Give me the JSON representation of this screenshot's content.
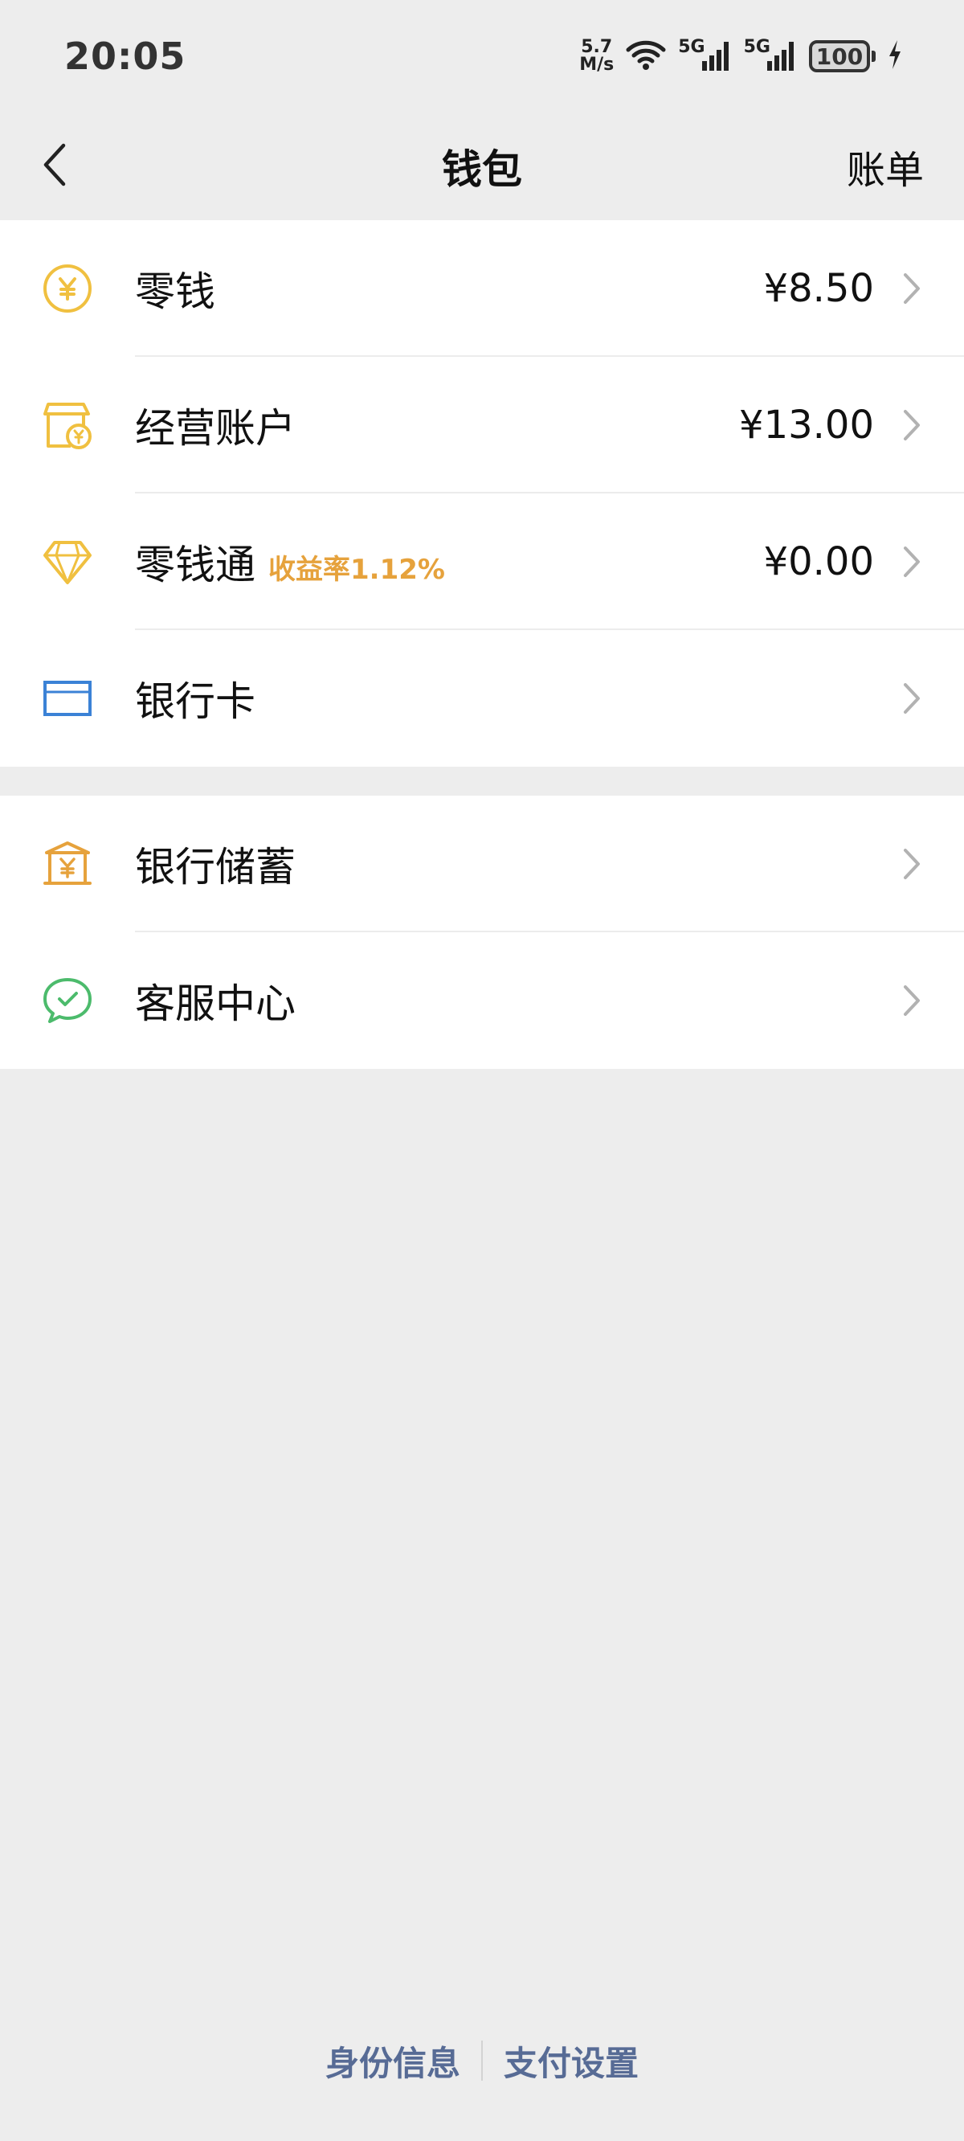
{
  "status_bar": {
    "time": "20:05",
    "net_speed_value": "5.7",
    "net_speed_unit": "M/s",
    "network_1": "5G",
    "network_2": "5G",
    "battery": "100",
    "icons": [
      "wifi-icon",
      "signal-icon",
      "signal-icon",
      "battery-icon",
      "charging-icon"
    ]
  },
  "nav": {
    "title": "钱包",
    "right_action": "账单",
    "back_icon": "back-arrow-icon"
  },
  "wallet_items": [
    {
      "label": "零钱",
      "value": "¥8.50",
      "icon": "yuan-coin-icon",
      "icon_color": "#f0c040"
    },
    {
      "label": "经营账户",
      "value": "¥13.00",
      "icon": "shop-yuan-icon",
      "icon_color": "#f0c040"
    },
    {
      "label": "零钱通",
      "rate": "收益率1.12%",
      "value": "¥0.00",
      "icon": "diamond-icon",
      "icon_color": "#f0c040"
    },
    {
      "label": "银行卡",
      "icon": "bank-card-icon",
      "icon_color": "#3b82d6"
    }
  ],
  "service_items": [
    {
      "label": "银行储蓄",
      "icon": "bank-savings-icon",
      "icon_color": "#e6a23c"
    },
    {
      "label": "客服中心",
      "icon": "customer-service-icon",
      "icon_color": "#4cbb6c"
    }
  ],
  "footer": {
    "identity_link": "身份信息",
    "payment_settings_link": "支付设置"
  },
  "colors": {
    "background": "#ededed",
    "card": "#ffffff",
    "rate_orange": "#e6a23c",
    "link_blue": "#576b95"
  }
}
